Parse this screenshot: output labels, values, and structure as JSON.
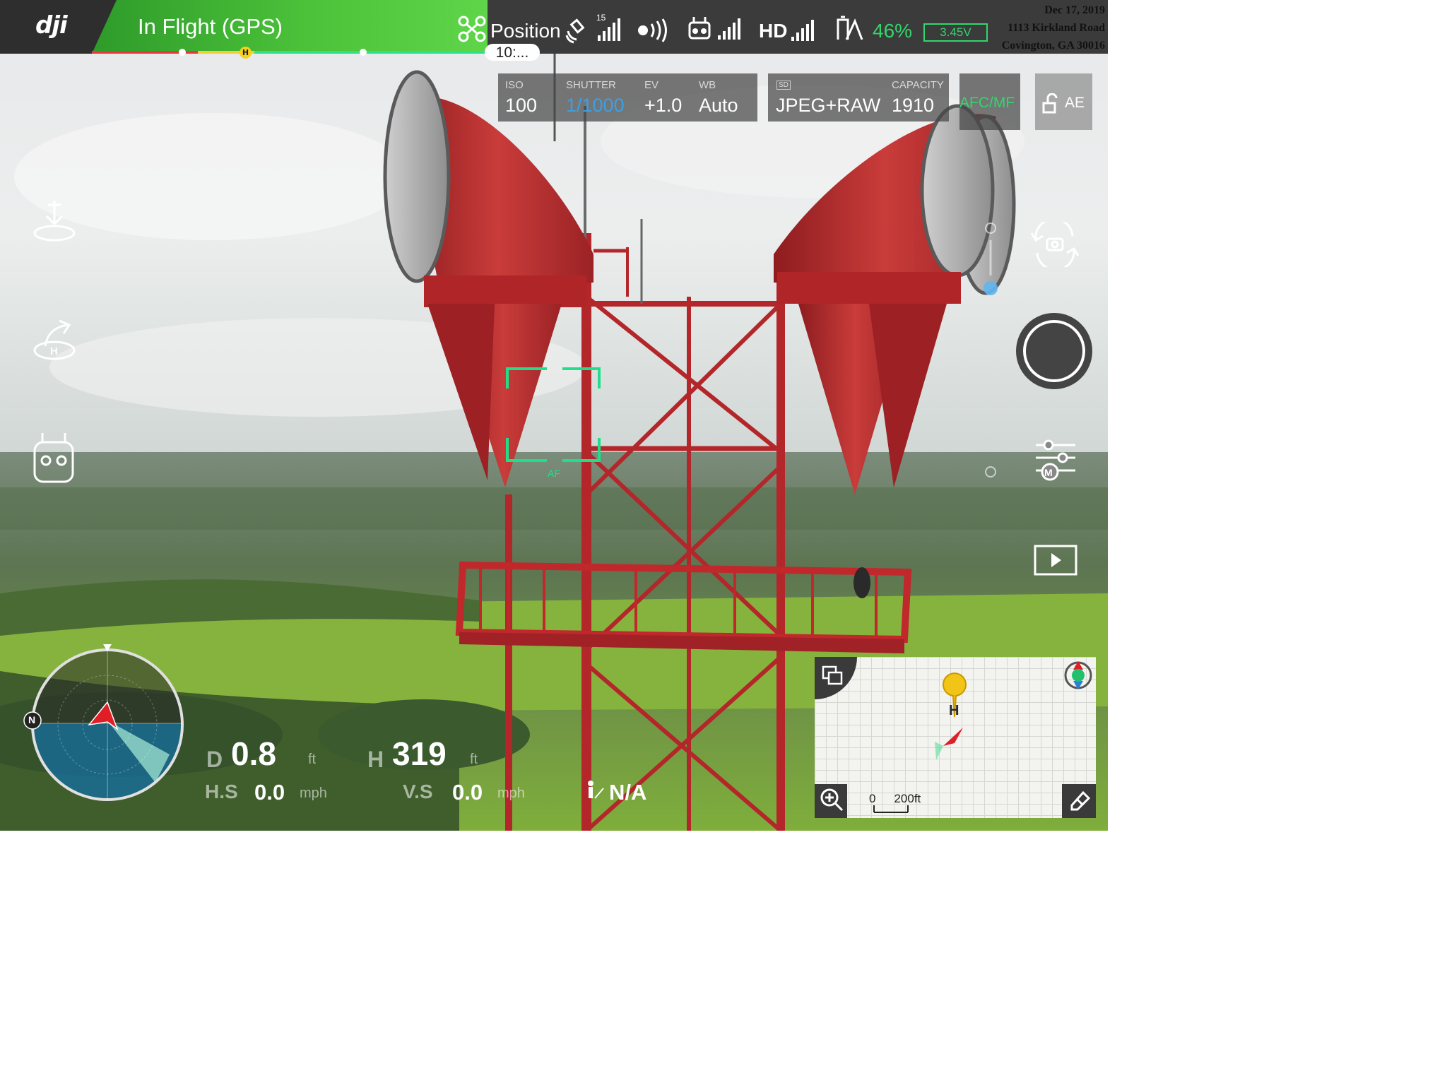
{
  "app": {
    "logo": "dji",
    "flight_status": "In Flight (GPS)",
    "flight_time": "10:..."
  },
  "topbar": {
    "flight_mode": "Position",
    "gps_satellites": "15",
    "video_link": "HD",
    "battery_percent": "46%",
    "battery_voltage": "3.45V"
  },
  "stamp": {
    "date": "Dec 17, 2019",
    "address_line1": "1113 Kirkland Road",
    "address_line2": "Covington, GA 30016"
  },
  "camera": {
    "iso_label": "ISO",
    "iso": "100",
    "shutter_label": "SHUTTER",
    "shutter": "1/1000",
    "ev_label": "EV",
    "ev": "+1.0",
    "wb_label": "WB",
    "wb": "Auto",
    "storage_badge": "SD",
    "format": "JPEG+RAW",
    "capacity_label": "CAPACITY",
    "capacity": "1910",
    "focus_mode": "AFC/MF",
    "ae_lock": "AE",
    "af_label": "AF"
  },
  "telemetry": {
    "d_label": "D",
    "distance": "0.8",
    "distance_unit": "ft",
    "h_label": "H",
    "height": "319",
    "height_unit": "ft",
    "hs_label": "H.S",
    "h_speed": "0.0",
    "h_speed_unit": "mph",
    "vs_label": "V.S",
    "v_speed": "0.0",
    "v_speed_unit": "mph",
    "vps": "N/A"
  },
  "compass": {
    "north_label": "N"
  },
  "map": {
    "home_label": "H",
    "scale_start": "0",
    "scale_end": "200ft"
  },
  "colors": {
    "accent_green": "#32d66b",
    "status_green": "#4cc23a",
    "af_box": "#1fe08a",
    "tower_red": "#b3262a"
  }
}
